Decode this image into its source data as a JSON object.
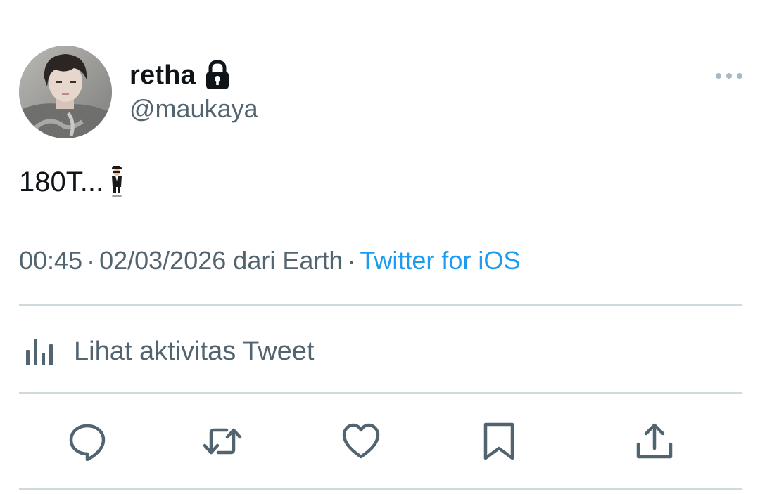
{
  "author": {
    "display_name": "retha",
    "handle": "@maukaya",
    "protected_icon": "lock-icon",
    "avatar": "profile-photo"
  },
  "tweet": {
    "text": "180T...",
    "emoji": "levitating-man-emoji",
    "time": "00:45",
    "date": "02/03/2026",
    "location_prefix": "dari",
    "location": "Earth",
    "source": "Twitter for iOS",
    "separator": "·"
  },
  "activity": {
    "label": "Lihat aktivitas Tweet",
    "icon": "analytics-icon"
  },
  "actions": [
    {
      "name": "reply",
      "icon": "reply-icon"
    },
    {
      "name": "retweet",
      "icon": "retweet-icon"
    },
    {
      "name": "like",
      "icon": "like-icon"
    },
    {
      "name": "bookmark",
      "icon": "bookmark-icon"
    },
    {
      "name": "share",
      "icon": "share-icon"
    }
  ],
  "colors": {
    "text_primary": "#0f1419",
    "text_secondary": "#536471",
    "link": "#1d9bf0",
    "divider": "#cfd9de",
    "icon": "#536471"
  }
}
